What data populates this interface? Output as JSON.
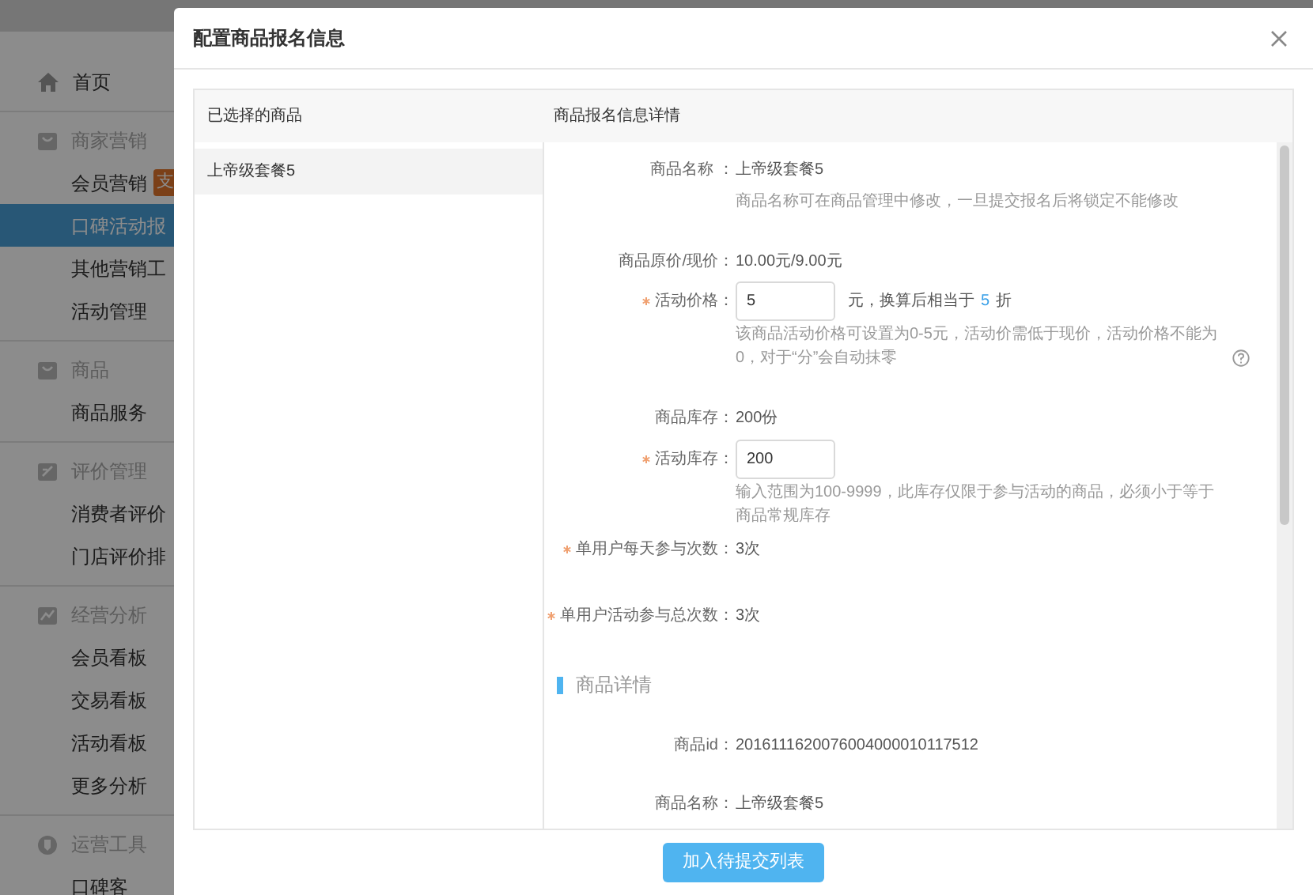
{
  "sidebar": {
    "home": {
      "label": "首页"
    },
    "groups": [
      {
        "label": "商家营销",
        "items": [
          {
            "label": "会员营销",
            "selected": false,
            "badge": "支"
          },
          {
            "label": "口碑活动报",
            "selected": true
          },
          {
            "label": "其他营销工",
            "selected": false
          },
          {
            "label": "活动管理",
            "selected": false
          }
        ]
      },
      {
        "label": "商品",
        "items": [
          {
            "label": "商品服务",
            "selected": false
          }
        ]
      },
      {
        "label": "评价管理",
        "items": [
          {
            "label": "消费者评价",
            "selected": false
          },
          {
            "label": "门店评价排",
            "selected": false
          }
        ]
      },
      {
        "label": "经营分析",
        "items": [
          {
            "label": "会员看板",
            "selected": false
          },
          {
            "label": "交易看板",
            "selected": false
          },
          {
            "label": "活动看板",
            "selected": false
          },
          {
            "label": "更多分析",
            "selected": false
          }
        ]
      },
      {
        "label": "运营工具",
        "items": [
          {
            "label": "口碑客",
            "selected": false
          }
        ]
      }
    ]
  },
  "dialog": {
    "title": "配置商品报名信息",
    "left": {
      "heading": "已选择的商品",
      "items": [
        {
          "label": "上帝级套餐5",
          "selected": true
        }
      ]
    },
    "right": {
      "heading": "商品报名信息详情",
      "fields": [
        {
          "kind": "text",
          "required": false,
          "label": "商品名称 ：",
          "value": "上帝级套餐5",
          "hint": "商品名称可在商品管理中修改，一旦提交报名后将锁定不能修改"
        },
        {
          "kind": "text",
          "required": false,
          "label": "商品原价/现价：",
          "value": "10.00元/9.00元"
        },
        {
          "kind": "input",
          "required": true,
          "label": "活动价格：",
          "value": "5",
          "suffix": "元，换算后相当于",
          "discount": "5",
          "unit": "折",
          "hint": "该商品活动价格可设置为0-5元，活动价需低于现价，活动价格不能为0，对于“分”会自动抹零",
          "help": true
        },
        {
          "kind": "text",
          "required": false,
          "label": "商品库存：",
          "value": "200份"
        },
        {
          "kind": "input",
          "required": true,
          "label": "活动库存：",
          "value": "200",
          "hint": "输入范围为100-9999，此库存仅限于参与活动的商品，必须小于等于商品常规库存"
        },
        {
          "kind": "text",
          "required": true,
          "label": "单用户每天参与次数：",
          "value": "3次"
        },
        {
          "kind": "text",
          "required": true,
          "label": "单用户活动参与总次数：",
          "value": "3次"
        }
      ],
      "section": "商品详情",
      "details": [
        {
          "label": "商品id：",
          "value": "2016111620076004000010117512"
        },
        {
          "label": "商品名称：",
          "value": "上帝级套餐5"
        }
      ]
    },
    "submit": "加入待提交列表"
  }
}
